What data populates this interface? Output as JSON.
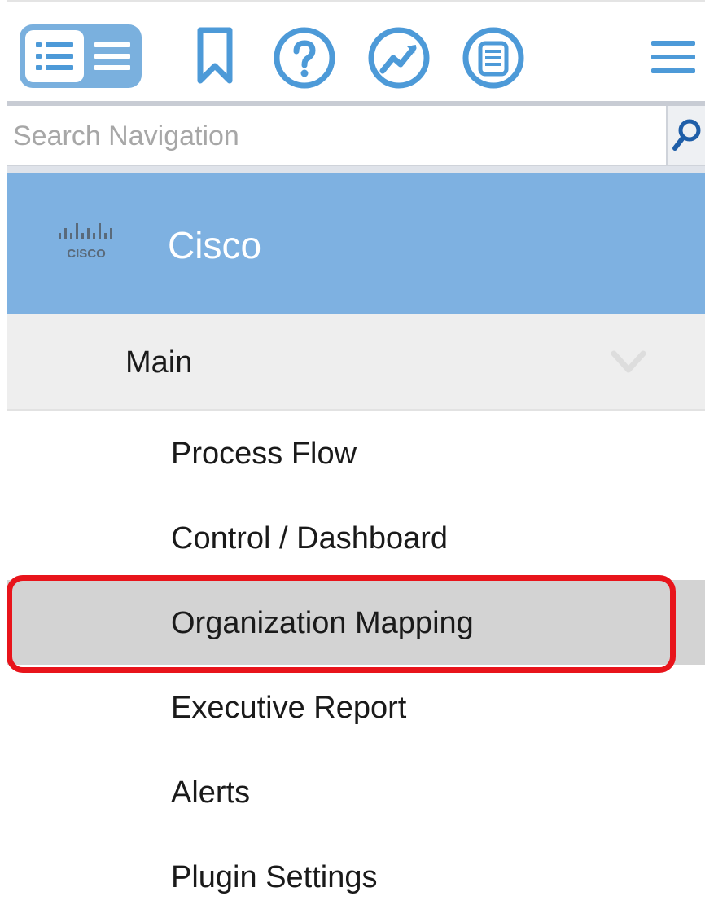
{
  "toolbar": {
    "icons": [
      "list-view-icon",
      "bookmark-icon",
      "help-icon",
      "trend-icon",
      "database-icon",
      "hamburger-menu-icon"
    ],
    "accent_color": "#4d9ad8"
  },
  "search": {
    "placeholder": "Search Navigation"
  },
  "brand": {
    "name": "Cisco",
    "logo_text": "CISCO",
    "header_color": "#7eb1e1"
  },
  "section": {
    "label": "Main"
  },
  "menu": {
    "items": [
      {
        "label": "Process Flow"
      },
      {
        "label": "Control / Dashboard"
      },
      {
        "label": "Organization Mapping",
        "selected": true
      },
      {
        "label": "Executive Report"
      },
      {
        "label": "Alerts"
      },
      {
        "label": "Plugin Settings"
      }
    ]
  },
  "highlight_color": "#e8141b"
}
